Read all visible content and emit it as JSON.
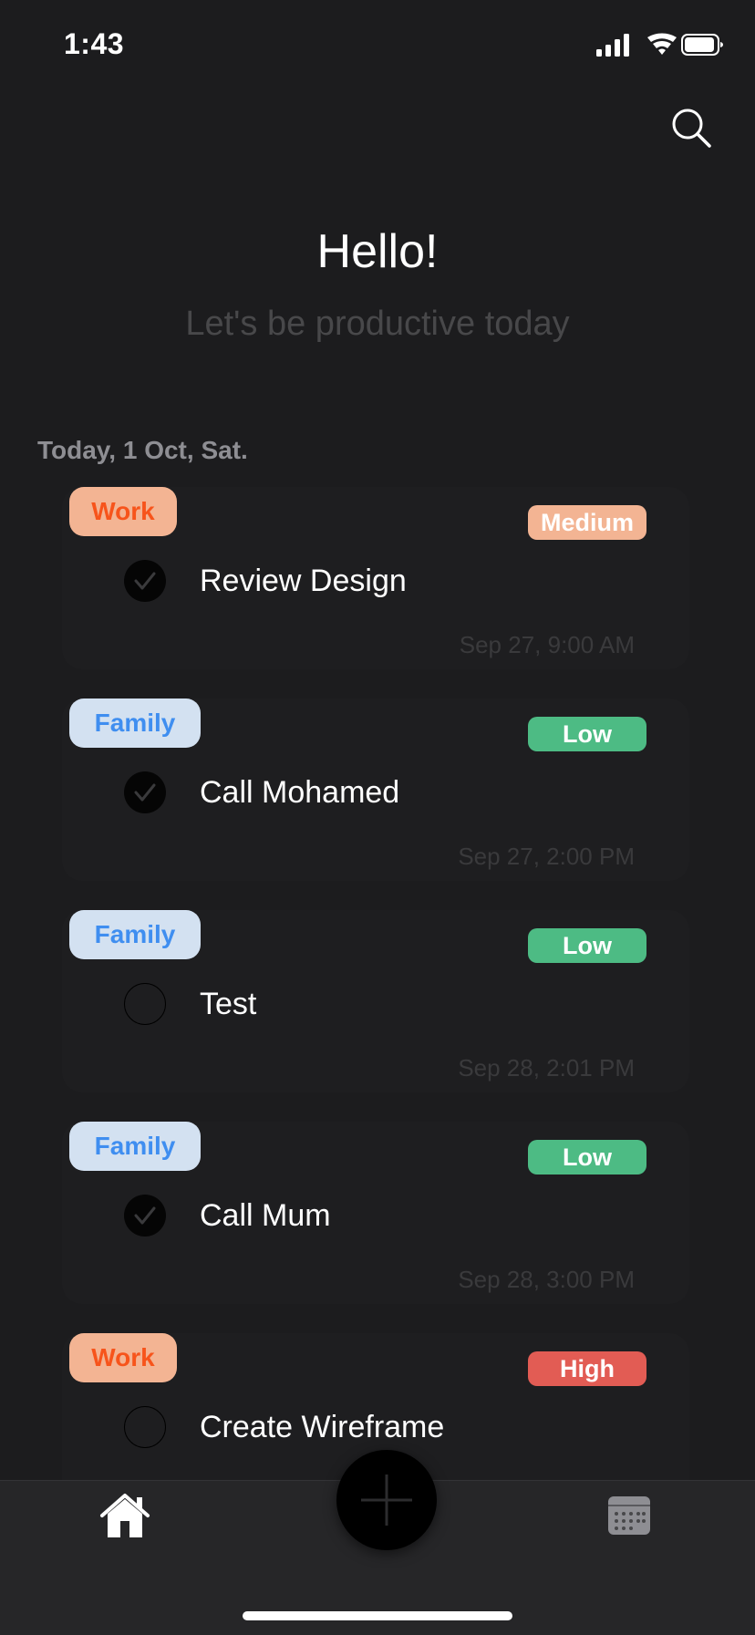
{
  "status_bar": {
    "time": "1:43"
  },
  "header": {
    "greeting": "Hello!",
    "subtitle": "Let's be productive today",
    "search_icon": "search-icon"
  },
  "date_label": "Today, 1 Oct, Sat.",
  "colors": {
    "background": "#1c1c1e",
    "work_tag_bg": "#f3b493",
    "work_tag_text": "#f7541b",
    "family_tag_bg": "#d3e1f1",
    "family_tag_text": "#3f8ef0",
    "medium": "#f3b493",
    "low": "#4dbb84",
    "high": "#e25c54"
  },
  "tasks": [
    {
      "category": "Work",
      "priority": "Medium",
      "title": "Review Design",
      "time": "Sep 27, 9:00 AM",
      "completed": true
    },
    {
      "category": "Family",
      "priority": "Low",
      "title": "Call Mohamed",
      "time": "Sep 27, 2:00 PM",
      "completed": true
    },
    {
      "category": "Family",
      "priority": "Low",
      "title": "Test",
      "time": "Sep 28, 2:01 PM",
      "completed": false
    },
    {
      "category": "Family",
      "priority": "Low",
      "title": "Call Mum",
      "time": "Sep 28, 3:00 PM",
      "completed": true
    },
    {
      "category": "Work",
      "priority": "High",
      "title": "Create Wireframe",
      "time": "",
      "completed": false
    }
  ],
  "tab_bar": {
    "home_icon": "home-icon",
    "add_icon": "plus-icon",
    "calendar_icon": "calendar-icon"
  }
}
